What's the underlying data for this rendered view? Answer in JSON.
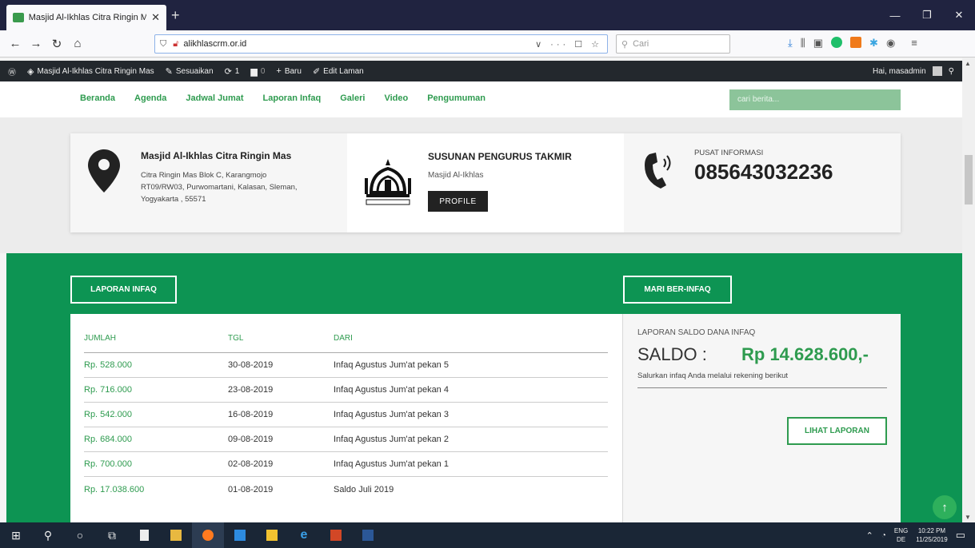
{
  "browser": {
    "tab_title": "Masjid Al-Ikhlas Citra Ringin M",
    "url": "alikhlascrm.or.id",
    "search_placeholder": "Cari",
    "url_tools": "∨ ··· ☐ ☆"
  },
  "adminbar": {
    "site_name": "Masjid Al-Ikhlas Citra Ringin Mas",
    "customize": "Sesuaikan",
    "updates": "1",
    "comments": "0",
    "new": "Baru",
    "edit": "Edit Laman",
    "greeting": "Hai, masadmin"
  },
  "menu": {
    "items": [
      "Beranda",
      "Agenda",
      "Jadwal Jumat",
      "Laporan Infaq",
      "Galeri",
      "Video",
      "Pengumuman"
    ],
    "search_placeholder": "cari berita..."
  },
  "info": {
    "address_title": "Masjid Al-Ikhlas Citra Ringin Mas",
    "address_line1": "Citra Ringin Mas Blok C, Karangmojo",
    "address_line2": "RT09/RW03, Purwomartani, Kalasan, Sleman,",
    "address_line3": "Yogyakarta , 55571",
    "structure_title": "SUSUNAN PENGURUS TAKMIR",
    "structure_sub": "Masjid Al-Ikhlas",
    "profile_button": "PROFILE",
    "center_label": "PUSAT INFORMASI",
    "phone": "085643032236"
  },
  "infaq": {
    "section_title": "LAPORAN INFAQ",
    "headers": [
      "JUMLAH",
      "TGL",
      "DARI"
    ],
    "rows": [
      {
        "amount": "Rp. 528.000",
        "date": "30-08-2019",
        "from": "Infaq Agustus Jum'at pekan 5"
      },
      {
        "amount": "Rp. 716.000",
        "date": "23-08-2019",
        "from": "Infaq Agustus Jum'at pekan 4"
      },
      {
        "amount": "Rp. 542.000",
        "date": "16-08-2019",
        "from": "Infaq Agustus Jum'at pekan 3"
      },
      {
        "amount": "Rp. 684.000",
        "date": "09-08-2019",
        "from": "Infaq Agustus Jum'at pekan 2"
      },
      {
        "amount": "Rp. 700.000",
        "date": "02-08-2019",
        "from": "Infaq Agustus Jum'at pekan 1"
      },
      {
        "amount": "Rp. 17.038.600",
        "date": "01-08-2019",
        "from": "Saldo Juli 2019"
      }
    ]
  },
  "donate": {
    "section_title": "MARI BER-INFAQ",
    "report_label": "LAPORAN SALDO DANA INFAQ",
    "saldo_word": "SALDO :",
    "saldo_value": "Rp 14.628.600,-",
    "transfer_note": "Salurkan infaq Anda melalui rekening berikut",
    "report_button": "LIHAT LAPORAN"
  },
  "taskbar": {
    "lang_top": "ENG",
    "lang_bottom": "DE",
    "time": "10:22 PM",
    "date": "11/25/2019"
  },
  "colors": {
    "brand_green": "#0d9453",
    "accent_green": "#2e9b4f",
    "admin_bar": "#23282d"
  }
}
